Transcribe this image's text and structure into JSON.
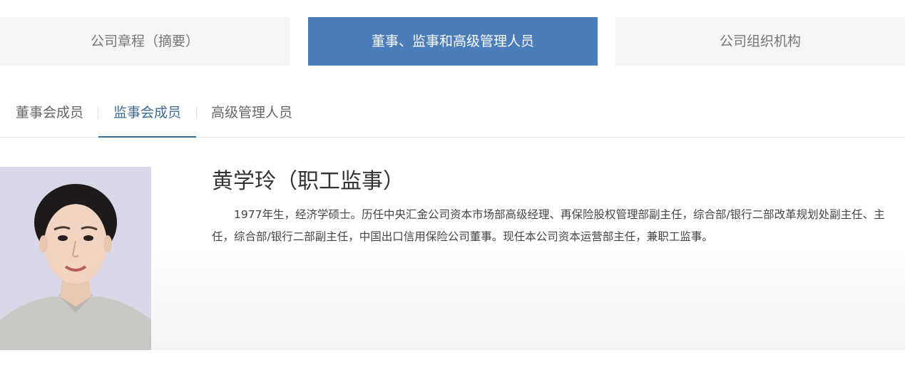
{
  "top_tabs": [
    {
      "label": "公司章程（摘要）"
    },
    {
      "label": "董事、监事和高级管理人员"
    },
    {
      "label": "公司组织机构"
    }
  ],
  "sub_tabs": [
    {
      "label": "董事会成员"
    },
    {
      "label": "监事会成员"
    },
    {
      "label": "高级管理人员"
    }
  ],
  "profile": {
    "name": "黄学玲（职工监事）",
    "bio": "1977年生，经济学硕士。历任中央汇金公司资本市场部高级经理、再保险股权管理部副主任，综合部/银行二部改革规划处副主任、主任，综合部/银行二部副主任，中国出口信用保险公司董事。现任本公司资本运营部主任，兼职工监事。"
  },
  "colors": {
    "active_tab_bg": "#4a7db9",
    "active_subtab": "#3f6c93",
    "inactive_tab_bg": "#f5f5f5"
  }
}
